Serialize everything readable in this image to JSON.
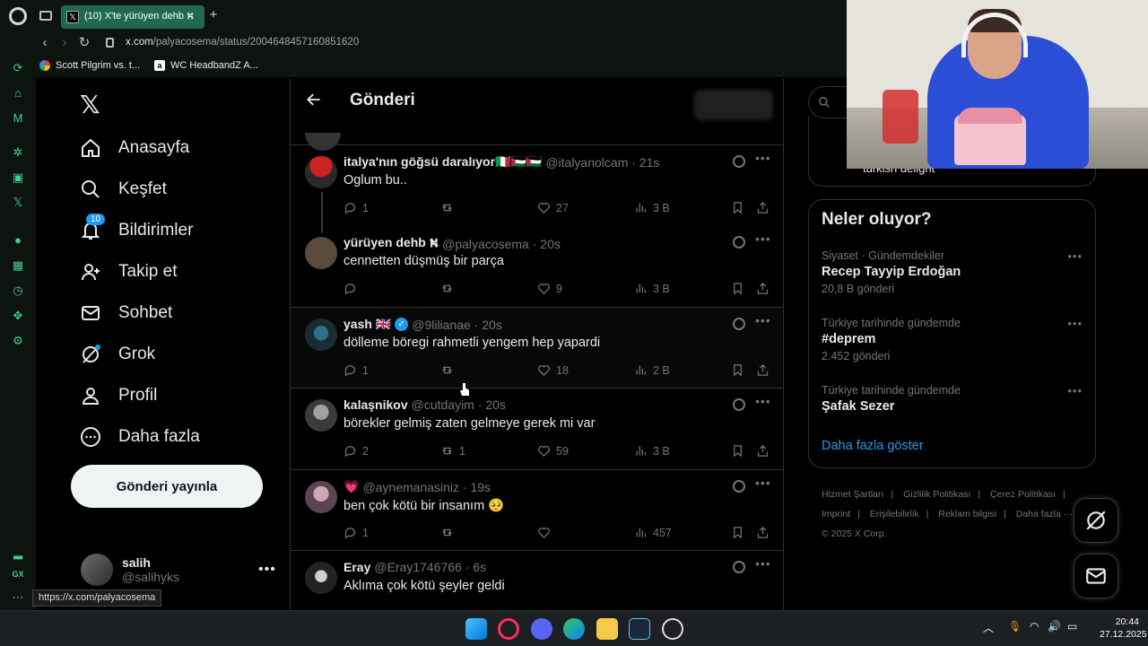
{
  "browser": {
    "tab_title": "(10) X'te yürüyen dehb ⛕",
    "url_domain": "x.com",
    "url_path": "/palyacosema/status/2004648457160851620",
    "bookmarks": [
      {
        "label": "Scott Pilgrim vs. t...",
        "icon": "google-icon"
      },
      {
        "label": "WC HeadbandZ A...",
        "icon": "amazon-icon"
      }
    ],
    "status_url": "https://x.com/palyacosema"
  },
  "nav": {
    "items": [
      {
        "label": "Anasayfa",
        "icon": "home-icon"
      },
      {
        "label": "Keşfet",
        "icon": "search-icon"
      },
      {
        "label": "Bildirimler",
        "icon": "bell-icon",
        "badge": "10"
      },
      {
        "label": "Takip et",
        "icon": "follow-icon"
      },
      {
        "label": "Sohbet",
        "icon": "mail-icon"
      },
      {
        "label": "Grok",
        "icon": "grok-icon"
      },
      {
        "label": "Profil",
        "icon": "profile-icon"
      },
      {
        "label": "Daha fazla",
        "icon": "more-circle-icon"
      }
    ],
    "post_button": "Gönderi yayınla",
    "me": {
      "name": "salih",
      "handle": "@salihyks"
    }
  },
  "main": {
    "title": "Gönderi",
    "tweets": [
      {
        "name": "italya'nın göğsü daralıyor🇮🇹🇵🇸🇵🇸",
        "handle": "@italyanolcam · 21s",
        "text": "Oglum bu..",
        "replies": "1",
        "retweets": "",
        "likes": "27",
        "views": "3 B",
        "avatar_color": "#7a1f1f"
      },
      {
        "name": "yürüyen dehb ⛕",
        "handle": "@palyacosema · 20s",
        "text": "cennetten düşmüş bir parça",
        "replies": "",
        "retweets": "",
        "likes": "9",
        "views": "3 B",
        "avatar_color": "#5a4a3a"
      },
      {
        "name": "yash 🇬🇧",
        "handle": "@9lilianae · 20s",
        "text": "dölleme böregi rahmetli yengem hep yapardi",
        "replies": "1",
        "retweets": "",
        "likes": "18",
        "views": "2 B",
        "avatar_color": "#1f3b4a",
        "verified": true
      },
      {
        "name": "kalaşnikov",
        "handle": "@cutdayim · 20s",
        "text": "börekler gelmiş zaten gelmeye gerek mi var",
        "replies": "2",
        "retweets": "1",
        "likes": "59",
        "views": "3 B",
        "avatar_color": "#6b6b6b"
      },
      {
        "name": "💗",
        "handle": "@aynemanasiniz · 19s",
        "text": "ben çok kötü bir insanım 🥺",
        "replies": "1",
        "retweets": "",
        "likes": "",
        "views": "457",
        "avatar_color": "#8a6f80"
      },
      {
        "name": "Eray",
        "handle": "@Eray1746766 · 6s",
        "text": "Aklıma çok kötü şeyler geldi",
        "replies": "",
        "retweets": "",
        "likes": "",
        "views": "",
        "avatar_color": "#3a3a3a"
      }
    ]
  },
  "right": {
    "top_card_text": "turkish delight",
    "trends_title": "Neler oluyor?",
    "trends": [
      {
        "context": "Siyaset · Gündemdekiler",
        "title": "Recep Tayyip Erdoğan",
        "count": "20,8 B gönderi"
      },
      {
        "context": "Türkiye tarihinde gündemde",
        "title": "#deprem",
        "count": "2.452 gönderi"
      },
      {
        "context": "Türkiye tarihinde gündemde",
        "title": "Şafak Sezer",
        "count": ""
      }
    ],
    "show_more": "Daha fazla göster",
    "footer_links": [
      "Hizmet Şartları",
      "|",
      "Gizlilik Politikası",
      "|",
      "Çerez Politikası",
      "|",
      "Imprint",
      "|",
      "Erişilebilirlik",
      "|",
      "Reklam bilgisi",
      "|",
      "Daha fazla ···"
    ],
    "copyright": "© 2025 X Corp."
  },
  "taskbar": {
    "time": "20:44",
    "date": "27.12.2025"
  }
}
